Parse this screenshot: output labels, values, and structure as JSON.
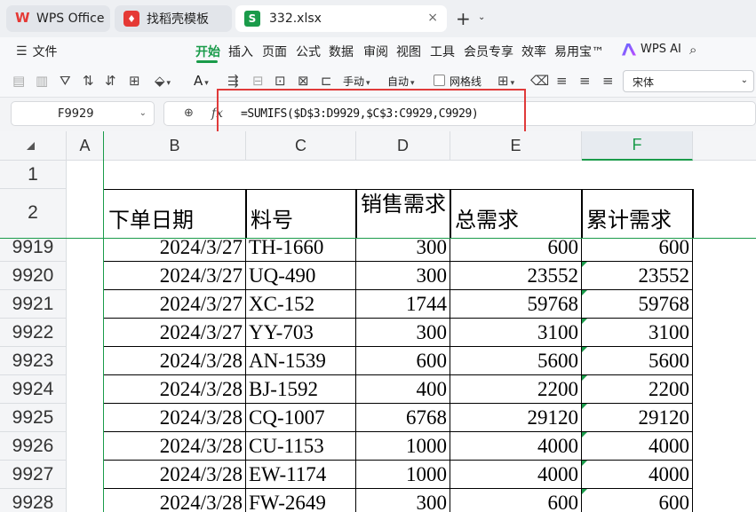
{
  "tabs": [
    {
      "label": "WPS Office",
      "icon": "wps-logo-icon"
    },
    {
      "label": "找稻壳模板",
      "icon": "docer-logo-icon"
    },
    {
      "label": "332.xlsx",
      "icon": "spreadsheet-s-icon",
      "close": "×"
    }
  ],
  "new_tab": "+",
  "menu": {
    "file": "文件",
    "items": [
      "开始",
      "插入",
      "页面",
      "公式",
      "数据",
      "审阅",
      "视图",
      "工具",
      "会员专享",
      "效率",
      "易用宝™"
    ],
    "active": "开始",
    "ai": "WPS AI"
  },
  "toolbar": {
    "manual": "手动",
    "auto": "自动",
    "gridlines": "网格线",
    "font": "宋体"
  },
  "formula_bar": {
    "name_box": "F9929",
    "fx": "fx",
    "formula": "=SUMIFS($D$3:D9929,$C$3:C9929,C9929)"
  },
  "colors": {
    "accent": "#1a9b4a",
    "highlight": "#e03a3a"
  },
  "sheet": {
    "columns": [
      "A",
      "B",
      "C",
      "D",
      "E",
      "F"
    ],
    "selected_column": "F",
    "header_rows": [
      "1",
      "2"
    ],
    "headers": [
      "下单日期",
      "料号",
      "销售需求",
      "总需求",
      "累计需求"
    ],
    "rows": [
      {
        "row": "9919",
        "date": "2024/3/27",
        "part": "TH-1660",
        "demand": "300",
        "total": "600",
        "cum": "600"
      },
      {
        "row": "9920",
        "date": "2024/3/27",
        "part": "UQ-490",
        "demand": "300",
        "total": "23552",
        "cum": "23552"
      },
      {
        "row": "9921",
        "date": "2024/3/27",
        "part": "XC-152",
        "demand": "1744",
        "total": "59768",
        "cum": "59768"
      },
      {
        "row": "9922",
        "date": "2024/3/27",
        "part": "YY-703",
        "demand": "300",
        "total": "3100",
        "cum": "3100"
      },
      {
        "row": "9923",
        "date": "2024/3/28",
        "part": "AN-1539",
        "demand": "600",
        "total": "5600",
        "cum": "5600"
      },
      {
        "row": "9924",
        "date": "2024/3/28",
        "part": "BJ-1592",
        "demand": "400",
        "total": "2200",
        "cum": "2200"
      },
      {
        "row": "9925",
        "date": "2024/3/28",
        "part": "CQ-1007",
        "demand": "6768",
        "total": "29120",
        "cum": "29120"
      },
      {
        "row": "9926",
        "date": "2024/3/28",
        "part": "CU-1153",
        "demand": "1000",
        "total": "4000",
        "cum": "4000"
      },
      {
        "row": "9927",
        "date": "2024/3/28",
        "part": "EW-1174",
        "demand": "1000",
        "total": "4000",
        "cum": "4000"
      },
      {
        "row": "9928",
        "date": "2024/3/28",
        "part": "FW-2649",
        "demand": "300",
        "total": "600",
        "cum": "600"
      }
    ]
  }
}
